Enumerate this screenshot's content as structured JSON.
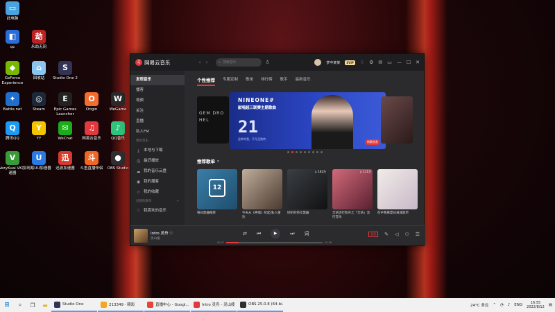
{
  "desktop": {
    "icons": [
      {
        "label": "此电脑",
        "color": "#4aa3df",
        "glyph": "▭"
      },
      {
        "label": "qc",
        "color": "#2a6cd8",
        "glyph": "◧"
      },
      {
        "label": "永劫无间",
        "color": "#b22",
        "glyph": "劫"
      },
      {
        "label": "GeForce Experience",
        "color": "#76b900",
        "glyph": "◆"
      },
      {
        "label": "回收站",
        "color": "#8bc4ee",
        "glyph": "⌂"
      },
      {
        "label": "Studio One 2",
        "color": "#335",
        "glyph": "S"
      },
      {
        "label": "Battle.net",
        "color": "#1f6fd0",
        "glyph": "✦"
      },
      {
        "label": "Steam",
        "color": "#1b2838",
        "glyph": "◎"
      },
      {
        "label": "Epic Games Launcher",
        "color": "#222",
        "glyph": "E"
      },
      {
        "label": "Origin",
        "color": "#f56c2d",
        "glyph": "O"
      },
      {
        "label": "WeGame",
        "color": "#2a2a2a",
        "glyph": "W"
      },
      {
        "label": "英雄联盟WeGame版",
        "color": "#1a2a4a",
        "glyph": "L"
      },
      {
        "label": "腾讯QQ",
        "color": "#1b9bf5",
        "glyph": "Q"
      },
      {
        "label": "YY",
        "color": "#f5c400",
        "glyph": "Y"
      },
      {
        "label": "WeChat",
        "color": "#1aad19",
        "glyph": "✉"
      },
      {
        "label": "网易云音乐",
        "color": "#e0393e",
        "glyph": "♫"
      },
      {
        "label": "QQ音乐",
        "color": "#31c27c",
        "glyph": "♪"
      },
      {
        "label": "Google Chrome",
        "color": "#ea4335",
        "glyph": "◉"
      },
      {
        "label": "VeryKuai VK加速器",
        "color": "#3a9a3a",
        "glyph": "V"
      },
      {
        "label": "网易UU加速器",
        "color": "#2a7adf",
        "glyph": "U"
      },
      {
        "label": "迅游加速器",
        "color": "#d83a2a",
        "glyph": "迅"
      },
      {
        "label": "斗鱼直播伴侣",
        "color": "#f26522",
        "glyph": "斗"
      },
      {
        "label": "OBS Studio",
        "color": "#302e31",
        "glyph": "●"
      },
      {
        "label": "AirPlayer",
        "color": "#3a6ad8",
        "glyph": "▶"
      }
    ]
  },
  "app": {
    "name": "网易云音乐",
    "search_placeholder": "搜索音乐",
    "username": "梦中某某",
    "vip_badge": "SVIP",
    "window_controls": [
      "—",
      "☐",
      "✕"
    ]
  },
  "sidebar": {
    "items": [
      {
        "label": "发现音乐",
        "active": true
      },
      {
        "label": "播客"
      },
      {
        "label": "视频"
      },
      {
        "label": "关注"
      },
      {
        "label": "直播"
      },
      {
        "label": "私人FM"
      }
    ],
    "my_music_header": "我的音乐",
    "my_music": [
      {
        "label": "本地与下载",
        "icon": "⤓"
      },
      {
        "label": "最近播放",
        "icon": "◷"
      },
      {
        "label": "我的音乐云盘",
        "icon": "☁"
      },
      {
        "label": "我的播客",
        "icon": "◉"
      },
      {
        "label": "我的收藏",
        "icon": "☆"
      }
    ],
    "created_header": "创建的歌单",
    "created": [
      {
        "label": "我喜欢的音乐",
        "icon": "♡"
      }
    ]
  },
  "tabs": [
    {
      "label": "个性推荐",
      "active": true
    },
    {
      "label": "专属定制"
    },
    {
      "label": "歌单"
    },
    {
      "label": "排行榜"
    },
    {
      "label": "歌手"
    },
    {
      "label": "最新音乐"
    }
  ],
  "banner": {
    "left_text": "GEM DRO HEL",
    "title": "NINEONE#",
    "subtitle": "献唱超三联赛主题歌曲",
    "number": "21",
    "caption": "这种的我，不凡且独特",
    "badge": "新歌首发",
    "dots_total": 9,
    "dots_active": 1
  },
  "recommend": {
    "title": "推荐歌单",
    "arrow": "›",
    "cards": [
      {
        "title": "每日歌曲推荐",
        "plays": "",
        "color1": "#3a7ea8",
        "color2": "#1f4e6e",
        "calendar": "12"
      },
      {
        "title": "今天从《神魂》听起|私人雷达",
        "plays": "",
        "color1": "#bfae9a",
        "color2": "#4a3a30"
      },
      {
        "title": "好听的英文歌曲",
        "plays": "162万",
        "color1": "#3a3f44",
        "color2": "#111"
      },
      {
        "title": "华语流行新声之「华语」流行音乐",
        "plays": "111万",
        "color1": "#d26a7a",
        "color2": "#5a2030"
      },
      {
        "title": "在乎我看夏日海滩歌单",
        "plays": "",
        "color1": "#f0ece8",
        "color2": "#c9b8c8"
      }
    ]
  },
  "player": {
    "song": "Intro 灵舟",
    "artist": "灵山绫",
    "time_current": "00:27",
    "time_total": "03:28",
    "progress": 0.13,
    "quality": "极高"
  },
  "taskbar": {
    "tasks": [
      {
        "label": "Studio One",
        "color": "#335"
      },
      {
        "label": "213349 · 精彩",
        "color": "#f5a623"
      },
      {
        "label": "直播中心 - Googl...",
        "color": "#ea4335"
      },
      {
        "label": "Intro 灵舟 - 灵山绫",
        "color": "#e0393e"
      },
      {
        "label": "OBS 25.0.8 (64-bi...",
        "color": "#302e31"
      }
    ],
    "weather": "24°C 多云",
    "lang": "ENG",
    "time": "16:55",
    "date": "2022/8/12"
  }
}
